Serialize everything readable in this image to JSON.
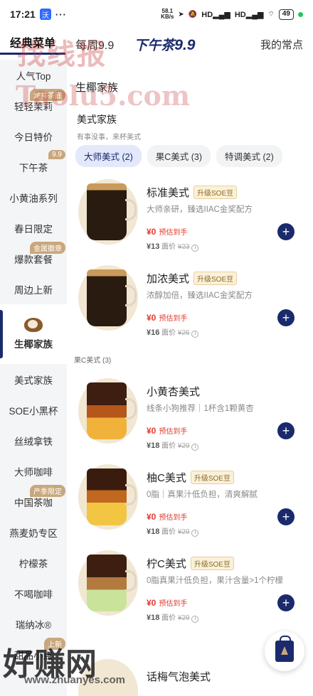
{
  "status_bar": {
    "time": "17:21",
    "app_badge": "沃",
    "dots": "···",
    "speed_top": "58.1",
    "speed_bottom": "KB/s",
    "signal1": "HD",
    "signal2": "HD",
    "battery": "49"
  },
  "top_tabs": [
    "经典菜单",
    "每周9.9",
    "下午茶",
    "9.9",
    "我的常点"
  ],
  "sidebar": {
    "items": [
      {
        "label": "人气Top",
        "tag": ""
      },
      {
        "label": "轻轻茉莉",
        "tag": "龙井茶底"
      },
      {
        "label": "今日特价",
        "tag": ""
      },
      {
        "label": "下午茶",
        "tag": "9.9"
      },
      {
        "label": "小黄油系列",
        "tag": ""
      },
      {
        "label": "春日限定",
        "tag": ""
      },
      {
        "label": "爆款套餐",
        "tag": "金属徽章"
      },
      {
        "label": "周边上新",
        "tag": ""
      },
      {
        "label": "生椰家族",
        "tag": ""
      },
      {
        "label": "美式家族",
        "tag": ""
      },
      {
        "label": "SOE小黑杯",
        "tag": ""
      },
      {
        "label": "丝绒拿铁",
        "tag": ""
      },
      {
        "label": "大师咖啡",
        "tag": ""
      },
      {
        "label": "中国茶咖",
        "tag": "产季限定"
      },
      {
        "label": "燕麦奶专区",
        "tag": ""
      },
      {
        "label": "柠檬茶",
        "tag": ""
      },
      {
        "label": "不喝咖啡",
        "tag": ""
      },
      {
        "label": "瑞纳冰®",
        "tag": ""
      },
      {
        "label": "甜品小点",
        "tag": "上新"
      }
    ]
  },
  "main": {
    "group_header": "生椰家族",
    "card_title": "美式家族",
    "card_sub": "有事没事，来杯美式",
    "chips": [
      "大师美式 (2)",
      "果C美式 (3)",
      "特调美式 (2)"
    ],
    "section_label": "果C美式 (3)",
    "products": [
      {
        "name": "标准美式",
        "badge": "升级SOE豆",
        "desc": "大师亲研，臻选IIAC金奖配方",
        "price": "¥0",
        "estimate": "预估到手",
        "face": "¥13",
        "face_label": "面价",
        "orig": "¥23"
      },
      {
        "name": "加浓美式",
        "badge": "升级SOE豆",
        "desc": "浓醇加倍，臻选IIAC金奖配方",
        "price": "¥0",
        "estimate": "预估到手",
        "face": "¥16",
        "face_label": "面价",
        "orig": "¥26"
      },
      {
        "name": "小黄杏美式",
        "badge": "",
        "desc": "线条小狗推荐｜1杯含1颗黄杏",
        "price": "¥0",
        "estimate": "预估到手",
        "face": "¥18",
        "face_label": "面价",
        "orig": "¥29"
      },
      {
        "name": "柚C美式",
        "badge": "升级SOE豆",
        "desc": "0脂｜真果汁低负担，清爽解腻",
        "price": "¥0",
        "estimate": "预估到手",
        "face": "¥18",
        "face_label": "面价",
        "orig": "¥29"
      },
      {
        "name": "柠C美式",
        "badge": "升级SOE豆",
        "desc": "0脂真果汁低负担，果汁含量>1个柠檬",
        "price": "¥0",
        "estimate": "预估到手",
        "face": "¥18",
        "face_label": "面价",
        "orig": "¥29"
      },
      {
        "name": "话梅气泡美式",
        "badge": "",
        "desc": "",
        "price": "",
        "estimate": "",
        "face": "",
        "face_label": "",
        "orig": ""
      }
    ],
    "add_icon": "+"
  },
  "watermarks": {
    "w1": "找线报",
    "w2": "Taolu5.com",
    "w3": "好赚网",
    "w4": "www.zhuanyes.com"
  },
  "colors": {
    "accent": "#1a2a6c",
    "price": "#e23b2e",
    "tag": "#c9a77c"
  }
}
